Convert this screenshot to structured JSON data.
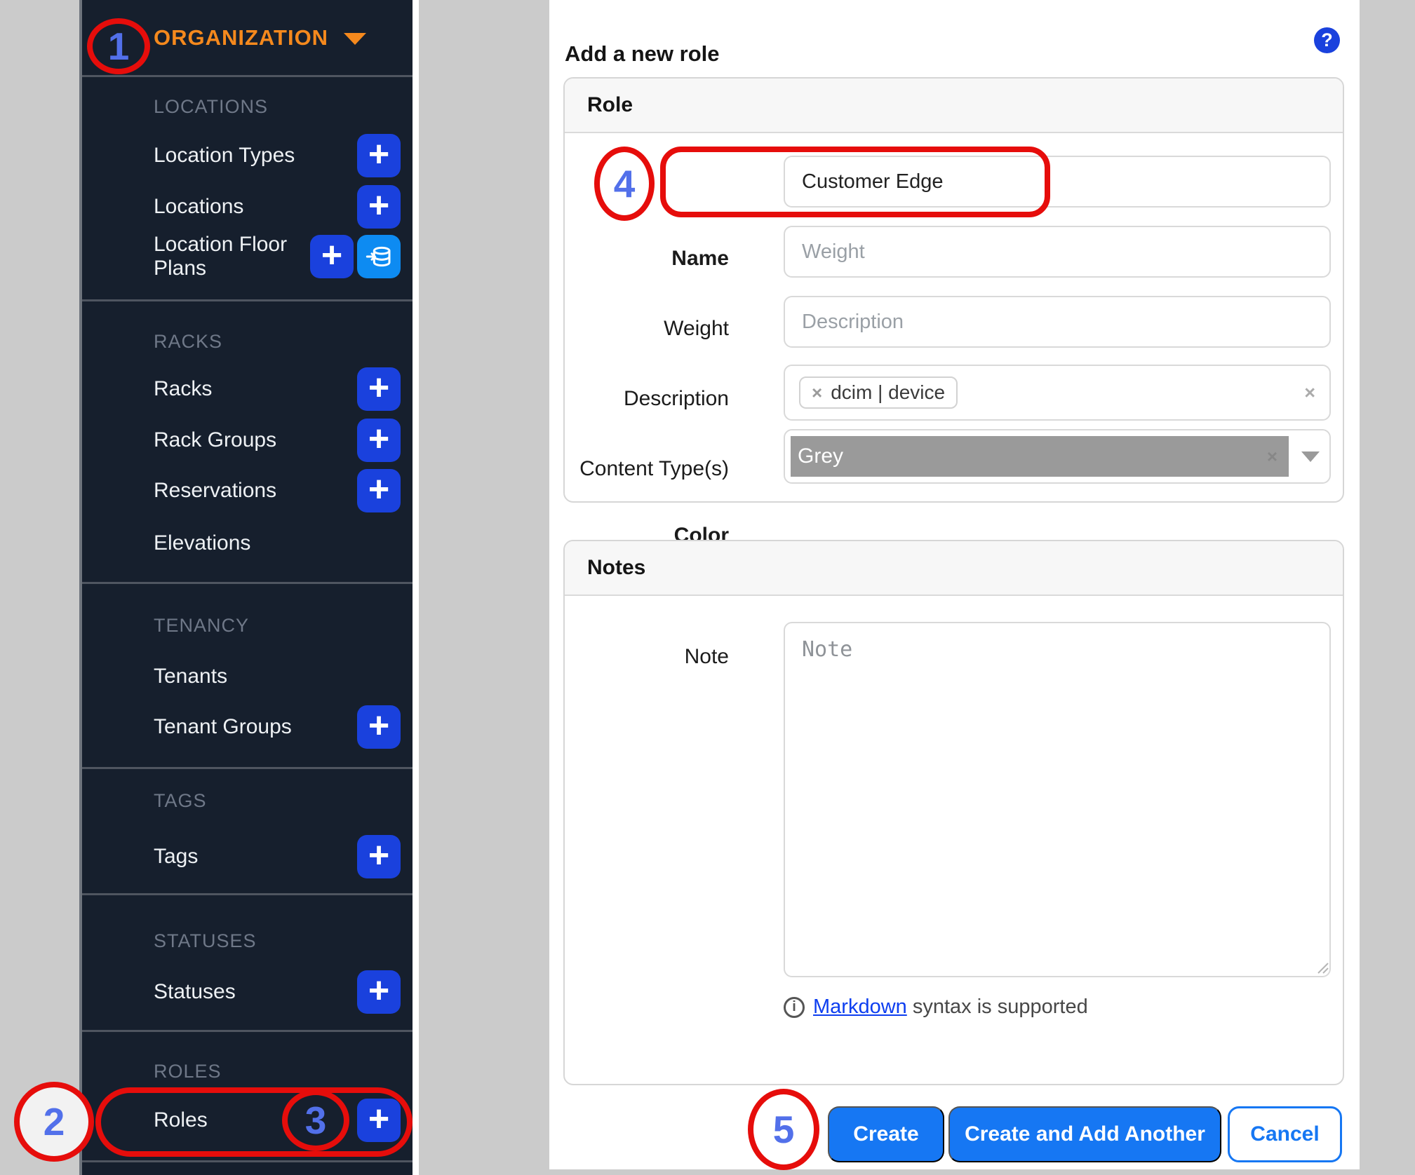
{
  "colors": {
    "sidebar_bg": "#161f2d",
    "sidebar_header_orange": "#f5891d",
    "plus_button_blue": "#1a41dd",
    "import_button_blue": "#0d8bf2",
    "action_button_blue": "#1677f3",
    "link_blue": "#0d3ef0",
    "annotation_red": "#e60d0b",
    "annotation_number_blue": "#5270ea",
    "color_swatch_grey": "#9a9a9a"
  },
  "glyphs": {
    "plus": "+",
    "remove_x": "×",
    "clear_x": "×",
    "question": "?",
    "info": "i"
  },
  "sidebar": {
    "header": "ORGANIZATION",
    "sections": [
      {
        "label": "LOCATIONS",
        "items": [
          {
            "label": "Location Types"
          },
          {
            "label": "Locations"
          },
          {
            "label": "Location Floor Plans"
          }
        ]
      },
      {
        "label": "RACKS",
        "items": [
          {
            "label": "Racks"
          },
          {
            "label": "Rack Groups"
          },
          {
            "label": "Reservations"
          },
          {
            "label": "Elevations"
          }
        ]
      },
      {
        "label": "TENANCY",
        "items": [
          {
            "label": "Tenants"
          },
          {
            "label": "Tenant Groups"
          }
        ]
      },
      {
        "label": "TAGS",
        "items": [
          {
            "label": "Tags"
          }
        ]
      },
      {
        "label": "STATUSES",
        "items": [
          {
            "label": "Statuses"
          }
        ]
      },
      {
        "label": "ROLES",
        "items": [
          {
            "label": "Roles"
          }
        ]
      }
    ]
  },
  "main": {
    "title": "Add a new role",
    "role_panel": {
      "title": "Role",
      "name_label": "Name",
      "name_value": "Customer Edge",
      "weight_label": "Weight",
      "weight_placeholder": "Weight",
      "description_label": "Description",
      "description_placeholder": "Description",
      "content_types_label": "Content Type(s)",
      "content_types_tag": "dcim | device",
      "color_label": "Color",
      "color_value": "Grey"
    },
    "notes_panel": {
      "title": "Notes",
      "note_label": "Note",
      "note_placeholder": "Note",
      "markdown_link": "Markdown",
      "markdown_text": "syntax is supported"
    },
    "buttons": {
      "create": "Create",
      "create_add": "Create and Add Another",
      "cancel": "Cancel"
    }
  },
  "annotations": {
    "step1": "1",
    "step2": "2",
    "step3": "3",
    "step4": "4",
    "step5": "5"
  }
}
